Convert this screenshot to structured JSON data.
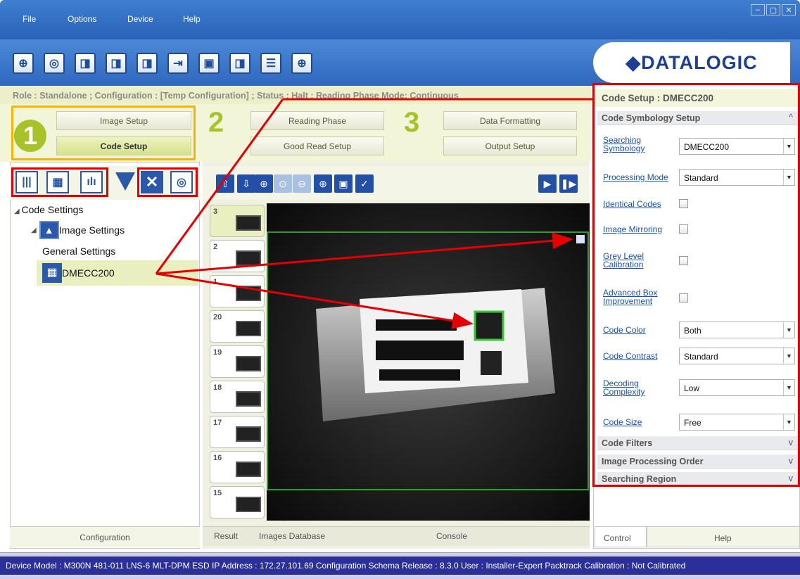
{
  "menu": {
    "file": "File",
    "options": "Options",
    "device": "Device",
    "help": "Help"
  },
  "window_controls": [
    "–",
    "▢",
    "✕"
  ],
  "brand": {
    "logo": "◆DATALOGIC"
  },
  "status_line": "Role : Standalone ; Configuration : [Temp Configuration] ; Status : Halt ; Reading Phase Mode: Continuous",
  "steps": {
    "step1": {
      "number": "1",
      "btn_top": "Image Setup",
      "btn_bottom": "Code Setup"
    },
    "step2": {
      "number": "2",
      "btn_top": "Reading Phase",
      "btn_bottom": "Good Read Setup"
    },
    "step3": {
      "number": "3",
      "btn_top": "Data Formatting",
      "btn_bottom": "Output Setup"
    }
  },
  "tree": {
    "root": "Code Settings",
    "child": "Image Settings",
    "general": "General Settings",
    "code": "DMECC200"
  },
  "left_panel_tab": "Configuration",
  "thumbnails": [
    "3",
    "2",
    "1",
    "20",
    "19",
    "18",
    "17",
    "16",
    "15"
  ],
  "center_tabs": {
    "result": "Result",
    "images": "Images Database",
    "console": "Console"
  },
  "right_panel": {
    "title": "Code Setup :  DMECC200",
    "section_open": "Code Symbology Setup",
    "fields": {
      "searching_symbology": {
        "label1": "Searching",
        "label2": "Symbology",
        "value": "DMECC200"
      },
      "processing_mode": {
        "label": "Processing Mode",
        "value": "Standard"
      },
      "identical_codes": {
        "label": "Identical Codes"
      },
      "image_mirroring": {
        "label": "Image Mirroring"
      },
      "grey_level": {
        "label1": "Grey Level",
        "label2": "Calibration"
      },
      "advanced_box": {
        "label1": "Advanced Box",
        "label2": "Improvement"
      },
      "code_color": {
        "label": "Code Color",
        "value": "Both"
      },
      "code_contrast": {
        "label": "Code Contrast",
        "value": "Standard"
      },
      "decoding_complexity": {
        "label1": "Decoding",
        "label2": "Complexity",
        "value": "Low"
      },
      "code_size": {
        "label": "Code Size",
        "value": "Free"
      }
    },
    "sections_closed": [
      "Code Filters",
      "Image Processing Order",
      "Searching Region"
    ],
    "tabs": {
      "control": "Control",
      "help": "Help"
    }
  },
  "statusbar": "Device Model : M300N  481-011  LNS-6 MLT-DPM ESD  IP Address : 172.27.101.69  Configuration Schema Release : 8.3.0  User : Installer-Expert  Packtrack Calibration : Not Calibrated",
  "colors": {
    "brand_blue": "#2f68bd",
    "accent_green": "#a8c32a",
    "highlight_orange": "#f4b400",
    "annotation_red": "#e40000"
  }
}
